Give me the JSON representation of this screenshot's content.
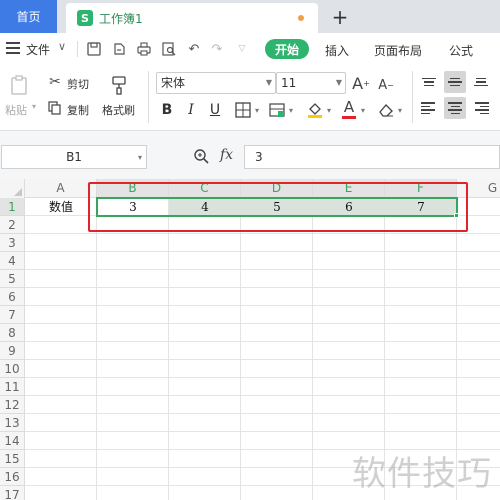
{
  "tabs": {
    "home": "首页",
    "doc_icon": "S",
    "doc_title": "工作簿1",
    "add": "+"
  },
  "menu": {
    "file": "文件",
    "start": "开始",
    "items": [
      "插入",
      "页面布局",
      "公式"
    ]
  },
  "ribbon": {
    "paste": "粘贴",
    "cut": "剪切",
    "copy": "复制",
    "format_painter": "格式刷",
    "font_name": "宋体",
    "font_size": "11",
    "bold": "B",
    "italic": "I",
    "underline": "U",
    "font_color_letter": "A",
    "grow_font": "A",
    "shrink_font": "A"
  },
  "formula_bar": {
    "name_box": "B1",
    "fx": "fx",
    "value": "3"
  },
  "sheet": {
    "columns": [
      "A",
      "B",
      "C",
      "D",
      "E",
      "F",
      "G"
    ],
    "rows": [
      "1",
      "2",
      "3",
      "4",
      "5",
      "6",
      "7",
      "8",
      "9",
      "10",
      "11",
      "12",
      "13",
      "14",
      "15",
      "16",
      "17"
    ],
    "row1": {
      "label": "数值",
      "values": [
        "3",
        "4",
        "5",
        "6",
        "7"
      ]
    }
  },
  "colors": {
    "accent_green": "#2eb46f",
    "selection_green": "#3aa35d",
    "home_tab": "#3f7be4",
    "highlight_red": "#e0242a"
  },
  "watermark": "软件技巧"
}
